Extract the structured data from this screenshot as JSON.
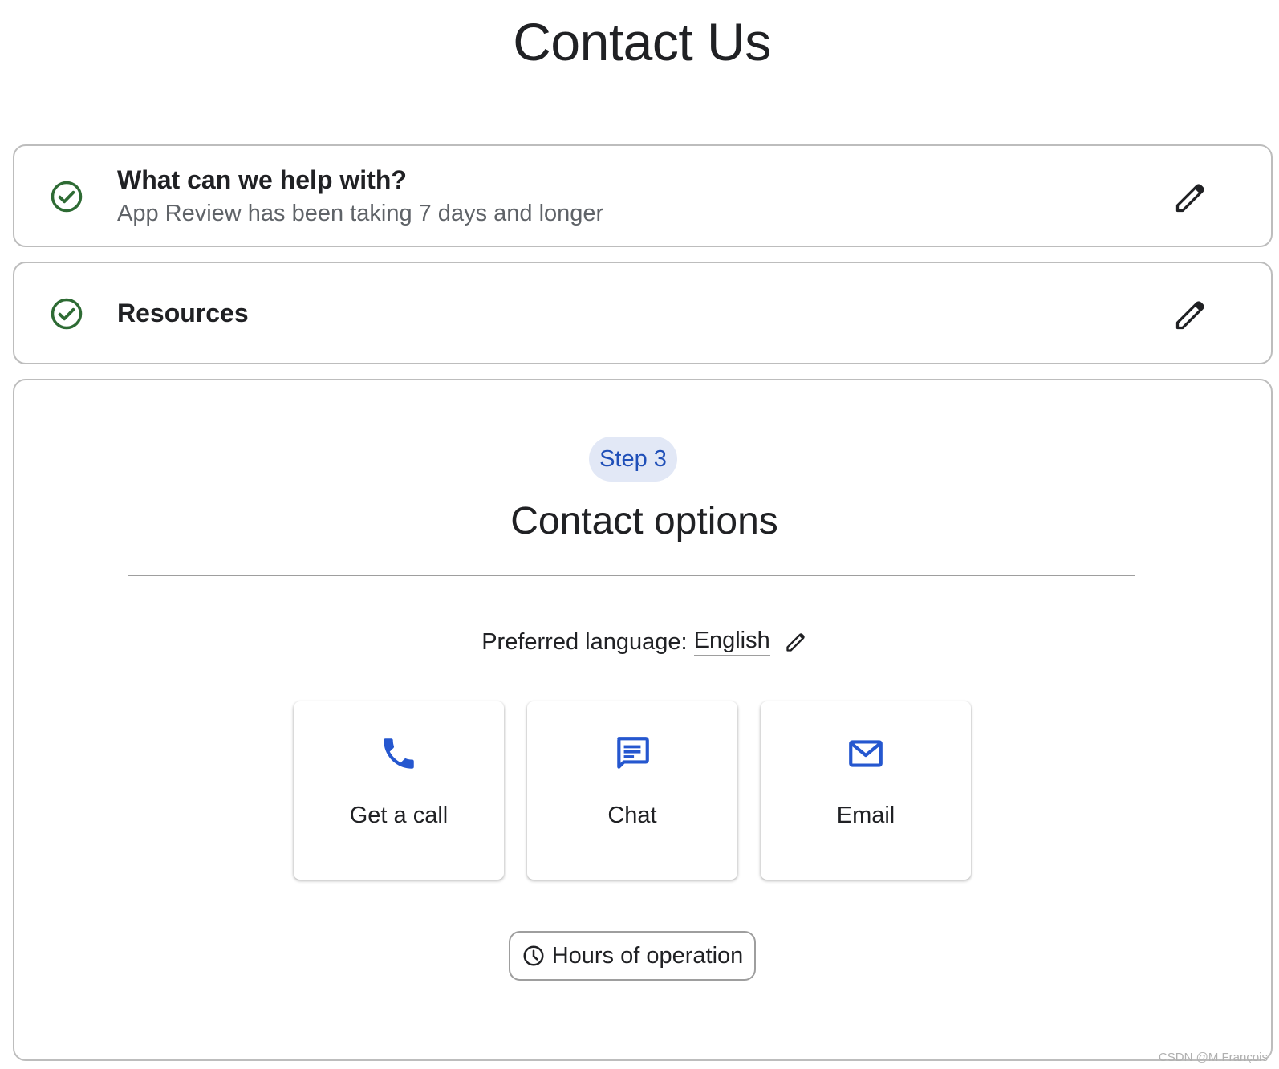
{
  "page": {
    "title": "Contact Us"
  },
  "steps": [
    {
      "title": "What can we help with?",
      "subtitle": "App Review has been taking 7 days and longer",
      "status_icon": "check-circle-icon",
      "edit_icon": "pencil-icon"
    },
    {
      "title": "Resources",
      "status_icon": "check-circle-icon",
      "edit_icon": "pencil-icon"
    }
  ],
  "contact": {
    "step_badge": "Step 3",
    "title": "Contact options",
    "language_label": "Preferred language:",
    "language_value": "English",
    "options": [
      {
        "label": "Get a call",
        "icon": "phone-icon"
      },
      {
        "label": "Chat",
        "icon": "chat-icon"
      },
      {
        "label": "Email",
        "icon": "email-icon"
      }
    ],
    "hours_button": "Hours of operation"
  },
  "colors": {
    "success_green": "#2e6b34",
    "accent_blue": "#2557cf",
    "badge_bg": "#e2e8f6",
    "badge_text": "#1f4fb8"
  },
  "watermark": "CSDN @M.François"
}
